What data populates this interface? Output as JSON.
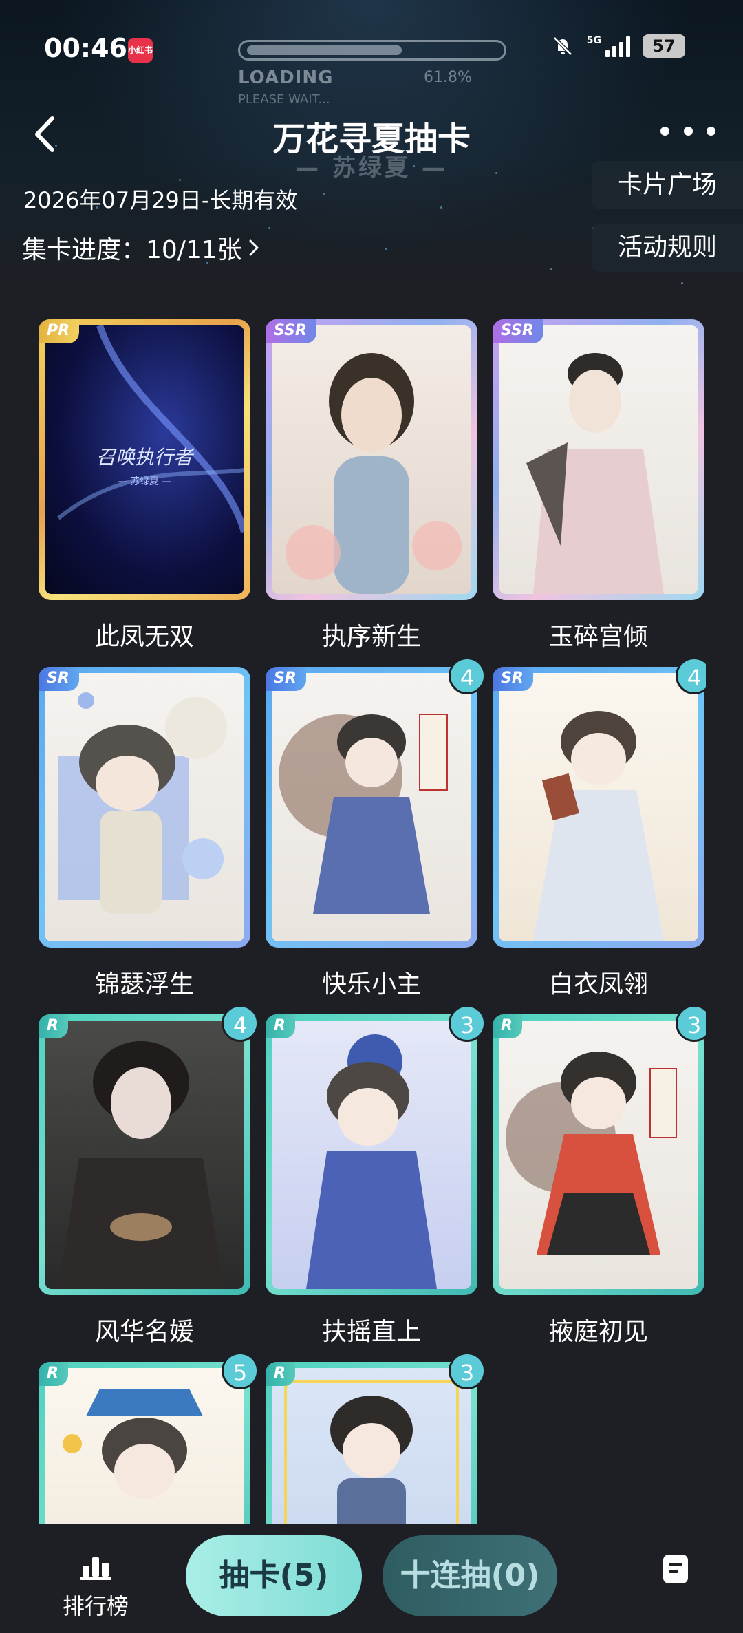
{
  "status": {
    "time": "00:46",
    "app_badge": "小红书",
    "loading": "LOADING",
    "loading_sub": "PLEASE WAIT...",
    "loading_pct": "61.8%",
    "loading_progress": 0.618,
    "network": "5G",
    "battery": "57"
  },
  "header": {
    "title": "万花寻夏抽卡",
    "subtitle": "— 苏绿夏 —",
    "date": "2026年07月29日-长期有效",
    "progress_label": "集卡进度：10/11张",
    "plaza_btn": "卡片广场",
    "rules_btn": "活动规则"
  },
  "cards": [
    {
      "tier": "PR",
      "name": "此凤无双",
      "count": null,
      "art_text": "召唤执行者",
      "art_sub": "— 苏绿夏 —"
    },
    {
      "tier": "SSR",
      "name": "执序新生",
      "count": null
    },
    {
      "tier": "SSR",
      "name": "玉碎宫倾",
      "count": null
    },
    {
      "tier": "SR",
      "name": "锦瑟浮生",
      "count": null
    },
    {
      "tier": "SR",
      "name": "快乐小主",
      "count": "4"
    },
    {
      "tier": "SR",
      "name": "白衣凤翎",
      "count": "4"
    },
    {
      "tier": "R",
      "name": "风华名媛",
      "count": "4"
    },
    {
      "tier": "R",
      "name": "扶摇直上",
      "count": "3"
    },
    {
      "tier": "R",
      "name": "掖庭初见",
      "count": "3"
    },
    {
      "tier": "R",
      "name": "",
      "count": "5"
    },
    {
      "tier": "R",
      "name": "",
      "count": "3"
    }
  ],
  "bottom": {
    "rank_label": "排行榜",
    "draw_btn": "抽卡(5)",
    "ten_draw_btn": "十连抽(0)"
  },
  "colors": {
    "background": "#1e1f24",
    "draw_btn": "#a9eee6",
    "ten_draw_btn": "#2e5d61",
    "count_badge": "#5ccbd8"
  }
}
